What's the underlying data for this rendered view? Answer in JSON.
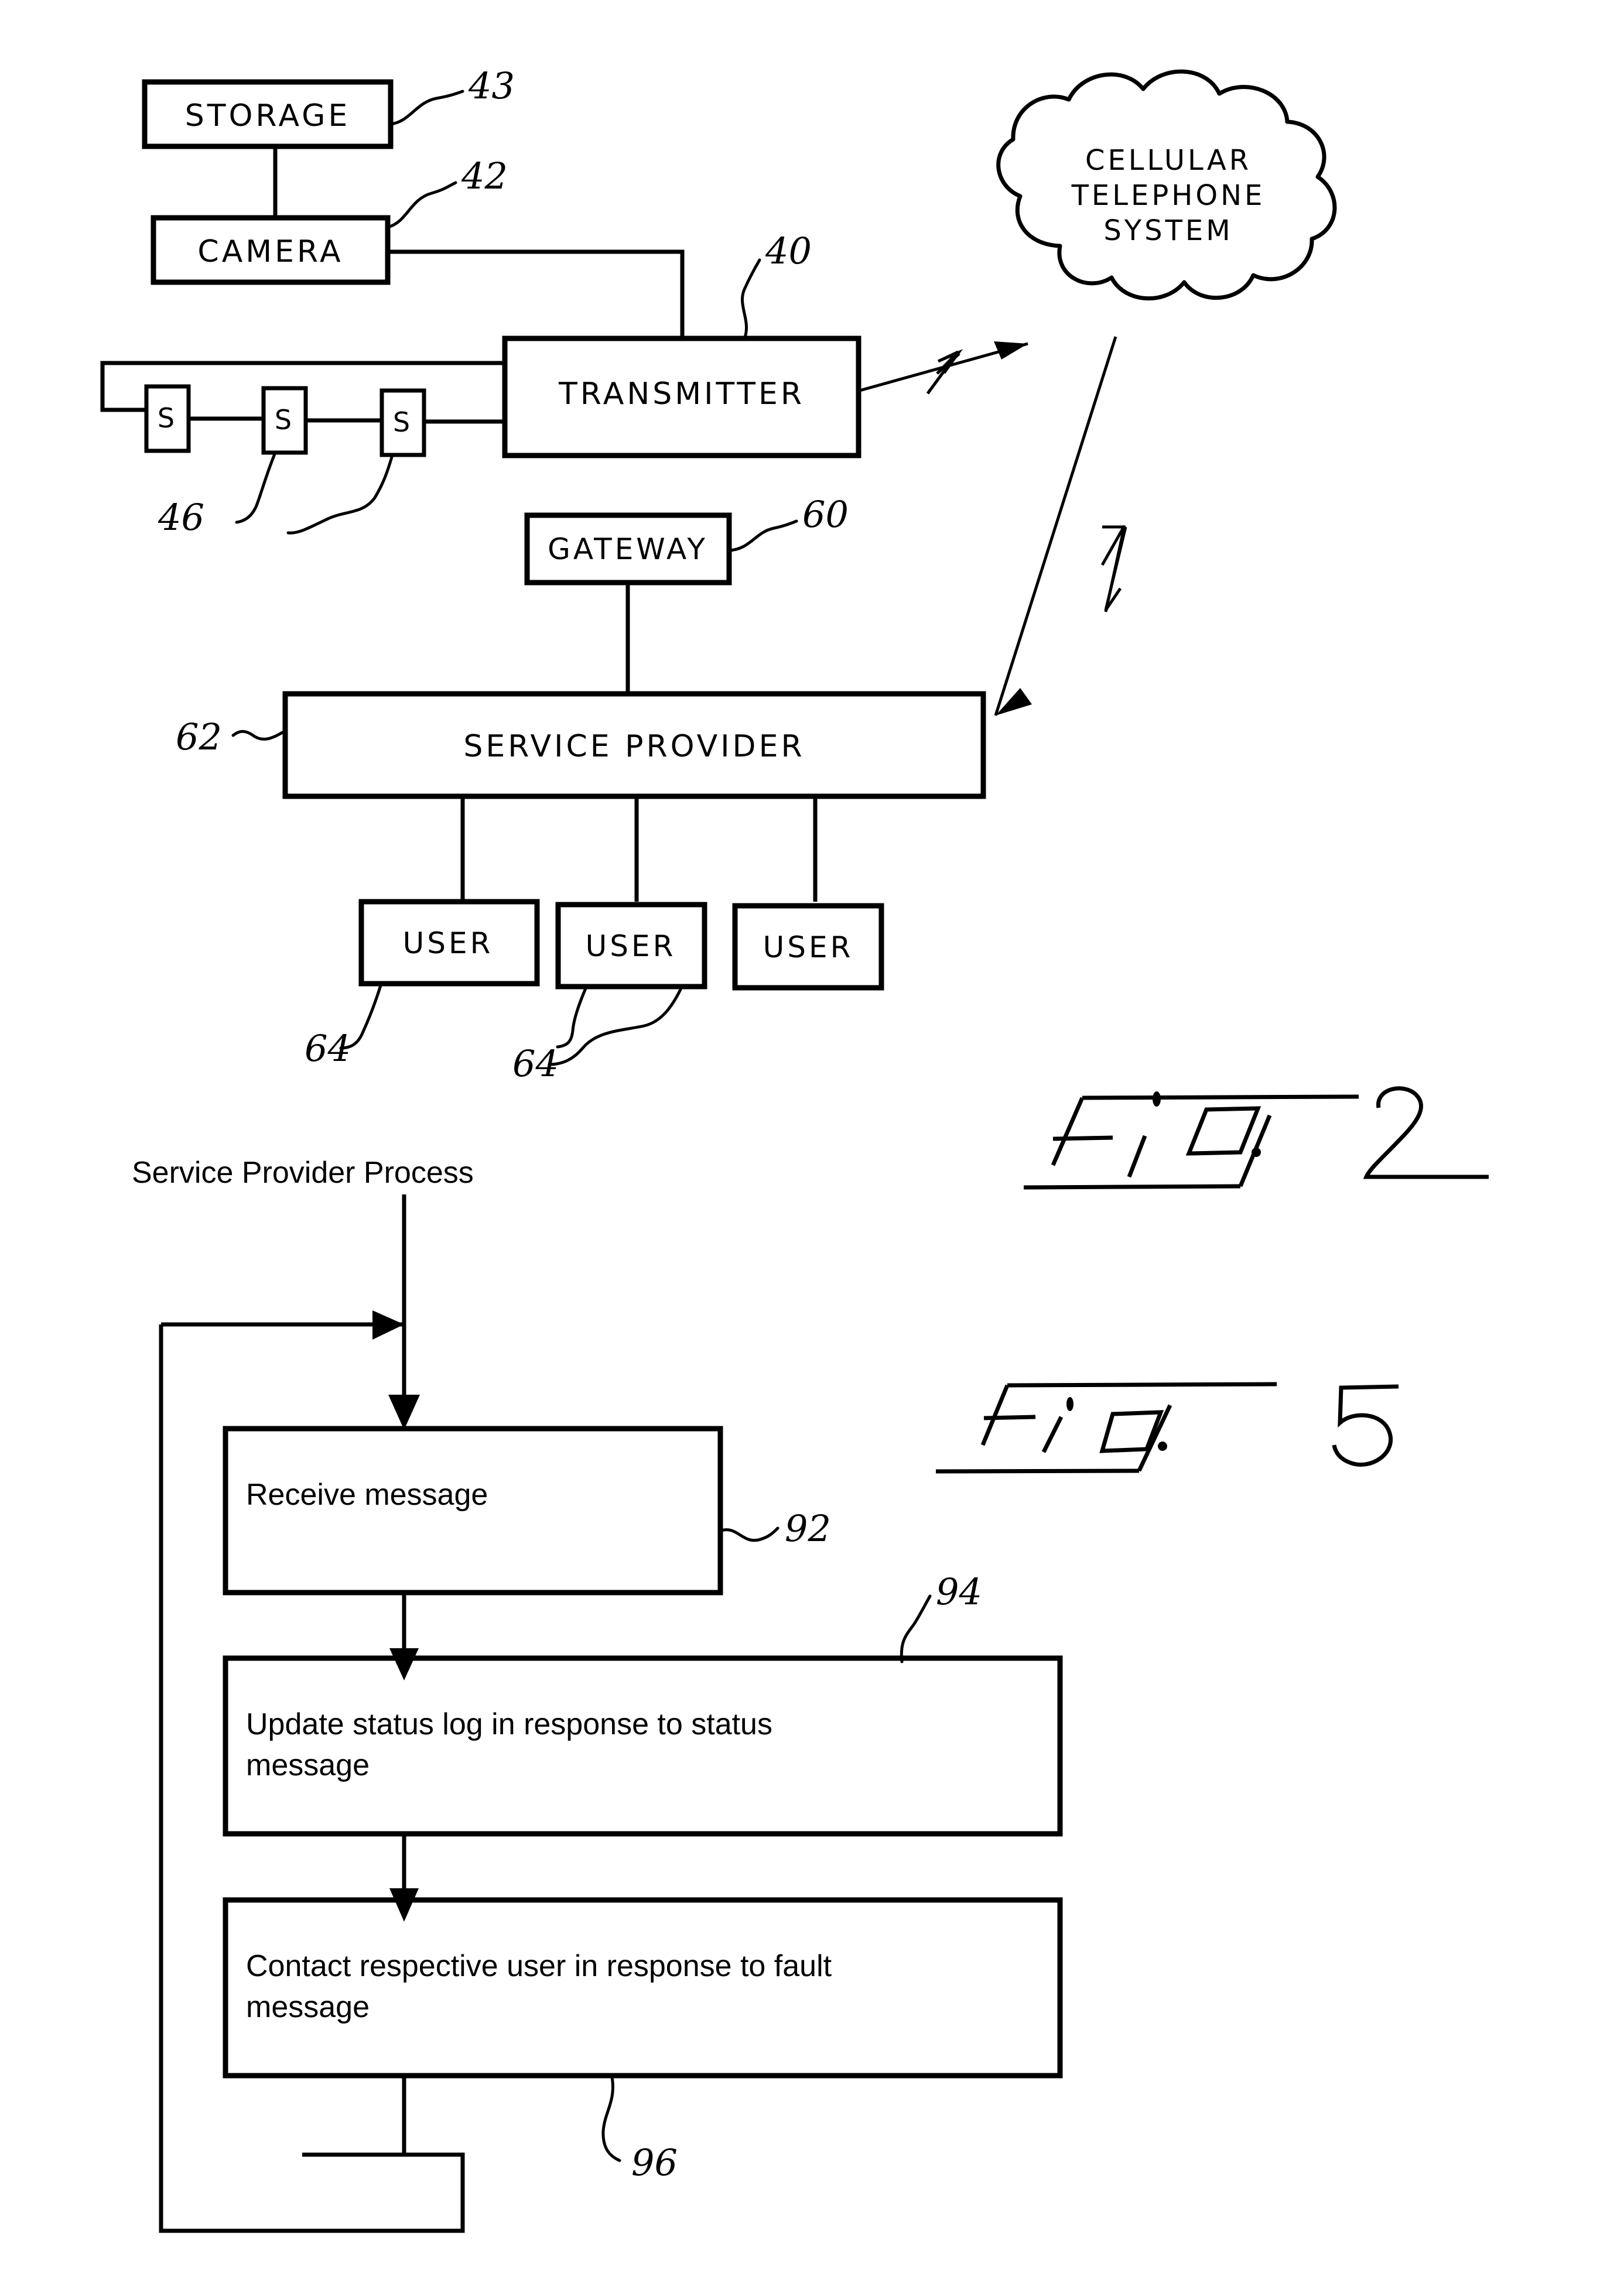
{
  "figure2": {
    "caption": "Fig. 2",
    "caption_word": "Fig.",
    "caption_number": "2",
    "blocks": [
      {
        "id": "storage",
        "label": "STORAGE",
        "ref": "43"
      },
      {
        "id": "camera",
        "label": "CAMERA",
        "ref": "42"
      },
      {
        "id": "transmitter",
        "label": "TRANSMITTER",
        "ref": "40"
      },
      {
        "id": "sensor1",
        "label": "S",
        "ref": "46"
      },
      {
        "id": "sensor2",
        "label": "S",
        "ref": "46"
      },
      {
        "id": "sensor3",
        "label": "S",
        "ref": "46"
      },
      {
        "id": "cloud",
        "label_line1": "CELLULAR",
        "label_line2": "TELEPHONE",
        "label_line3": "SYSTEM",
        "ref": ""
      },
      {
        "id": "gateway",
        "label": "GATEWAY",
        "ref": "60"
      },
      {
        "id": "service_provider",
        "label": "SERVICE  PROVIDER",
        "ref": "62"
      },
      {
        "id": "user1",
        "label": "USER",
        "ref": "64"
      },
      {
        "id": "user2",
        "label": "USER",
        "ref": "64"
      },
      {
        "id": "user3",
        "label": "USER",
        "ref": ""
      }
    ],
    "refs": {
      "storage": "43",
      "camera": "42",
      "transmitter": "40",
      "sensors": "46",
      "gateway": "60",
      "service_provider": "62",
      "user_left": "64",
      "user_mid": "64"
    }
  },
  "figure5": {
    "caption": "Fig. 5",
    "caption_word": "Fig.",
    "caption_number": "5",
    "title": "Service Provider Process",
    "steps": [
      {
        "id": "step92",
        "text": "Receive message",
        "ref": "92"
      },
      {
        "id": "step94",
        "text": "Update status log in response to status message",
        "line1": "Update status log in response to status",
        "line2": "message",
        "ref": "94"
      },
      {
        "id": "step96",
        "text": "Contact respective user in response to fault message",
        "line1": "Contact respective user in response to fault",
        "line2": "message",
        "ref": "96"
      }
    ]
  },
  "colors": {
    "ink": "#000000",
    "paper": "#ffffff"
  }
}
